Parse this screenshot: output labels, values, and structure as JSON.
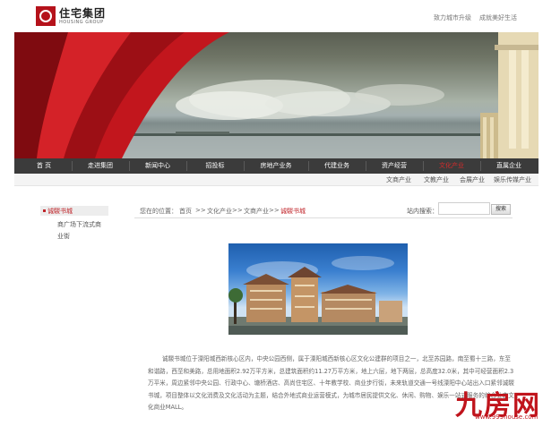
{
  "header": {
    "logo_cn": "住宅集团",
    "logo_en": "HOUSING GROUP",
    "slogan_left": "致力城市升级",
    "slogan_right": "成就美好生活"
  },
  "nav": {
    "items": [
      {
        "label": "首 页",
        "active": false
      },
      {
        "label": "走进集团",
        "active": false
      },
      {
        "label": "新闻中心",
        "active": false
      },
      {
        "label": "招投标",
        "active": false
      },
      {
        "label": "房地产业务",
        "active": false
      },
      {
        "label": "代建业务",
        "active": false
      },
      {
        "label": "资产经营",
        "active": false
      },
      {
        "label": "文化产业",
        "active": true
      },
      {
        "label": "直属企业",
        "active": false
      }
    ],
    "subitems": [
      "文商产业",
      "文教产业",
      "会展产业",
      "娱乐传媒产业"
    ]
  },
  "sidebar": {
    "active_item": "诚騣书城",
    "link_line1": "商广场下流式商",
    "link_line2": "业街"
  },
  "breadcrumb": {
    "prefix": "您在的位置：",
    "items": [
      "首页",
      "文化产业",
      "文商产业",
      "诚騣书城"
    ],
    "separator": ">>"
  },
  "search": {
    "label": "站内搜索：",
    "value": "",
    "button": "搜索"
  },
  "article": {
    "line1": "诚騣书城位于溧阳城西新核心区内，中央公园西侧，属于溧阳城西新核心区文化公建群的项目之一，北至苏园路，",
    "line2": "南至蜀十三路，东至和谐路，西至和美路，总用地面积2.92万平方米，总建筑面积约11.27万平方米，地上六层，地下两层，",
    "line3": "总高度32.0米，其中可经营面积2.3万平米，周边紧邻中央公园、行政中心、塘桥酒店、高尚住宅区、十年教学校、商业",
    "line4": "步行街，未来轨道交通一号线溧阳中心站出入口紧邻诚騣书城，项目整体以文化消费及文化活动为主题，结合外地式商业运营",
    "line5": "模式，为城市居民提供文化、休闲、购物、娱乐一站式服务的综合业态文化商业MALL。"
  },
  "watermark": {
    "text": "九房网",
    "url": "www.999house.com"
  },
  "colors": {
    "brand_red": "#b5121b",
    "nav_bg": "#3b3b3b",
    "active_red": "#d42b2b"
  }
}
